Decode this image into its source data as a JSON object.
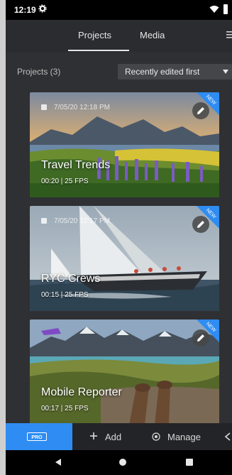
{
  "status_bar": {
    "time": "12:19"
  },
  "tabs": [
    {
      "label": "Projects"
    },
    {
      "label": "Media"
    }
  ],
  "projects_header": {
    "count_label": "Projects (3)",
    "sort_label": "Recently edited first"
  },
  "projects": [
    {
      "date": "7/05/20 12:18 PM",
      "title": "Travel Trends",
      "meta": "00:20 | 25 FPS",
      "badge": "NEW"
    },
    {
      "date": "7/05/20 12:17 PM",
      "title": "RYC Crews",
      "meta": "00:15 | 25 FPS",
      "badge": "NEW"
    },
    {
      "date": "",
      "title": "Mobile Reporter",
      "meta": "00:17 | 25 FPS",
      "badge": "NEW"
    }
  ],
  "bottom_bar": {
    "add_label": "Add",
    "manage_label": "Manage",
    "pro_label": "PRO"
  },
  "colors": {
    "accent": "#2f8cf2",
    "background": "#2f3033",
    "badge": "#2f8cf2"
  }
}
